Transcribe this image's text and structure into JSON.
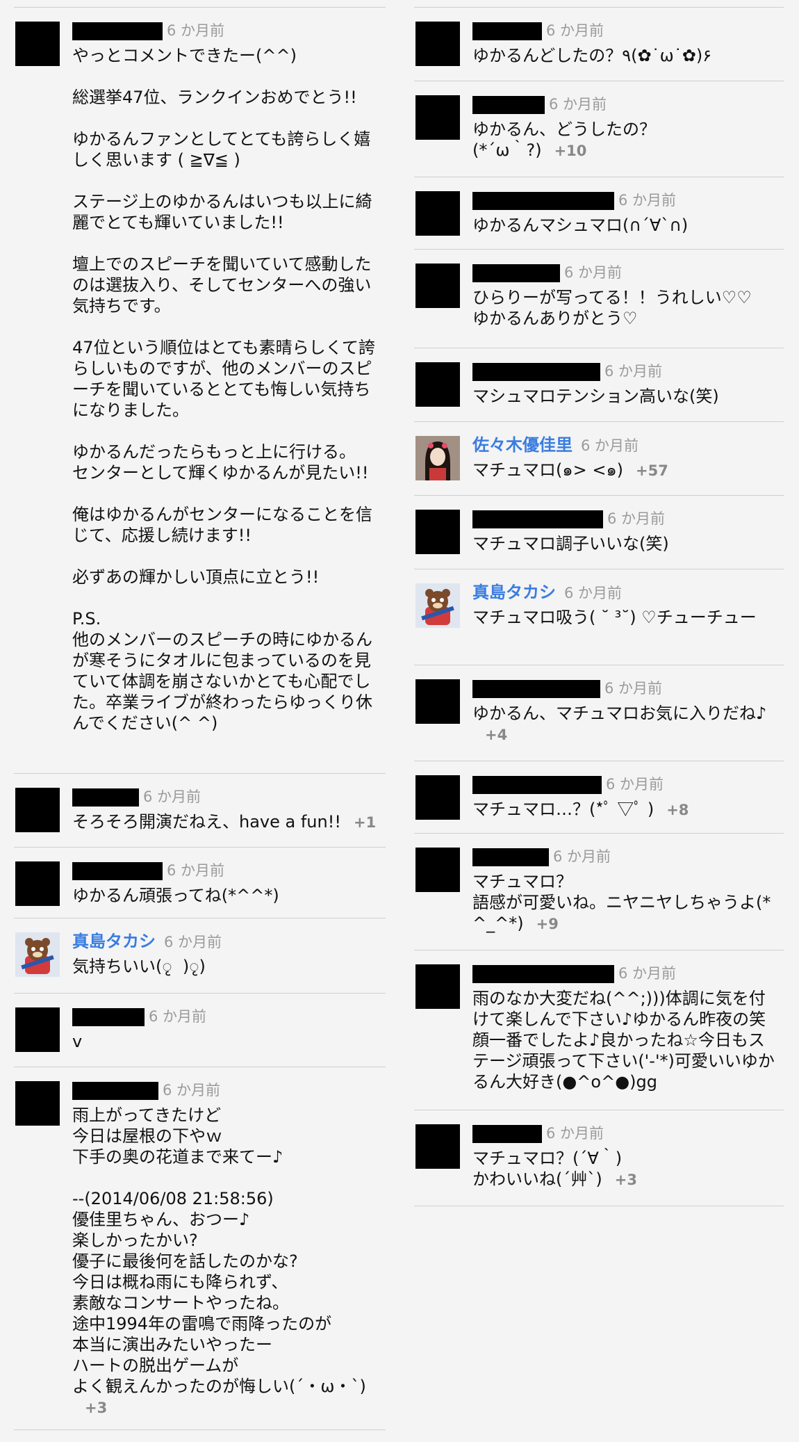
{
  "left_comments": [
    {
      "name": "",
      "time": "6 か月前",
      "body": "やっとコメントできたー(^^)\n\n総選挙47位、ランクインおめでとう!!\n\nゆかるんファンとしてとても誇らしく嬉しく思います ( ≧∇≦ )\n\nステージ上のゆかるんはいつも以上に綺麗でとても輝いていました!!\n\n壇上でのスピーチを聞いていて感動したのは選抜入り、そしてセンターへの強い気持ちです。\n\n47位という順位はとても素晴らしくて誇らしいものですが、他のメンバーのスピーチを聞いているととても悔しい気持ちになりました。\n\nゆかるんだったらもっと上に行ける。\nセンターとして輝くゆかるんが見たい!!\n\n俺はゆかるんがセンターになることを信じて、応援し続けます!!\n\n必ずあの輝かしい頂点に立とう!!\n\nP.S.\n他のメンバーのスピーチの時にゆかるんが寒そうにタオルに包まっているのを見ていて体調を崩さないかとても心配でした。卒業ライブが終わったらゆっくり休んでください(^ ^)",
      "plus": ""
    },
    {
      "name": "",
      "time": "6 か月前",
      "body": "そろそろ開演だねえ、have a fun!!",
      "plus": "+1"
    },
    {
      "name": "",
      "time": "6 か月前",
      "body": "ゆかるん頑張ってね(*^^*)",
      "plus": ""
    },
    {
      "name": "真島タカシ",
      "time": "6 か月前",
      "body": "気持ちいい(ृ  )ृ)",
      "plus": ""
    },
    {
      "name": "",
      "time": "6 か月前",
      "body": "v",
      "plus": ""
    },
    {
      "name": "",
      "time": "6 か月前",
      "body": "雨上がってきたけど\n今日は屋根の下やｗ\n下手の奥の花道まで来てー♪\n\n--(2014/06/08 21:58:56)\n優佳里ちゃん、おつー♪\n楽しかったかい?\n優子に最後何を話したのかな?\n今日は概ね雨にも降られず、\n素敵なコンサートやったね。\n途中1994年の雷鳴で雨降ったのが\n本当に演出みたいやったー\nハートの脱出ゲームが\nよく観えんかったのが悔しい(´・ω・`)",
      "plus": "+3"
    }
  ],
  "right_comments": [
    {
      "name": "",
      "time": "6 か月前",
      "body": "ゆかるんどしたの？٩(✿˙ω˙✿)۶",
      "plus": ""
    },
    {
      "name": "",
      "time": "6 か月前",
      "body": "ゆかるん、どうしたの？\n(*´ω｀?)",
      "plus": "+10"
    },
    {
      "name": "",
      "time": "6 か月前",
      "body": "ゆかるんマシュマロ(∩´∀`∩)",
      "plus": ""
    },
    {
      "name": "",
      "time": "6 か月前",
      "body": "ひらりーが写ってる！！うれしい♡♡\nゆかるんありがとう♡",
      "plus": ""
    },
    {
      "name": "",
      "time": "6 か月前",
      "body": "マシュマロテンション高いな(笑)",
      "plus": ""
    },
    {
      "name": "佐々木優佳里",
      "time": "6 か月前",
      "body": "マチュマロ(๑> <๑)",
      "plus": "+57"
    },
    {
      "name": "",
      "time": "6 か月前",
      "body": "マチュマロ調子いいな(笑)",
      "plus": ""
    },
    {
      "name": "真島タカシ",
      "time": "6 か月前",
      "body": "マチュマロ吸う( ˘ ³˘) ♡チューチュー",
      "plus": ""
    },
    {
      "name": "",
      "time": "6 か月前",
      "body": "ゆかるん、マチュマロお気に入りだね♪",
      "plus": "+4"
    },
    {
      "name": "",
      "time": "6 か月前",
      "body": "マチュマロ…？(*ﾟ ▽ﾟ )",
      "plus": "+8"
    },
    {
      "name": "",
      "time": "6 か月前",
      "body": "マチュマロ？\n語感が可愛いね。ニヤニヤしちゃうよ(*^_^*)",
      "plus": "+9"
    },
    {
      "name": "",
      "time": "6 か月前",
      "body": "雨のなか大変だね(^^;)))体調に気を付けて楽しんで下さい♪ゆかるん昨夜の笑顔一番でしたよ♪良かったね☆今日もステージ頑張って下さい('-'*)可愛いいゆかるん大好き(●^o^●)gg",
      "plus": ""
    },
    {
      "name": "",
      "time": "6 か月前",
      "body": "マチュマロ？(´∀｀)\nかわいいね(´艸`)",
      "plus": "+3"
    }
  ]
}
